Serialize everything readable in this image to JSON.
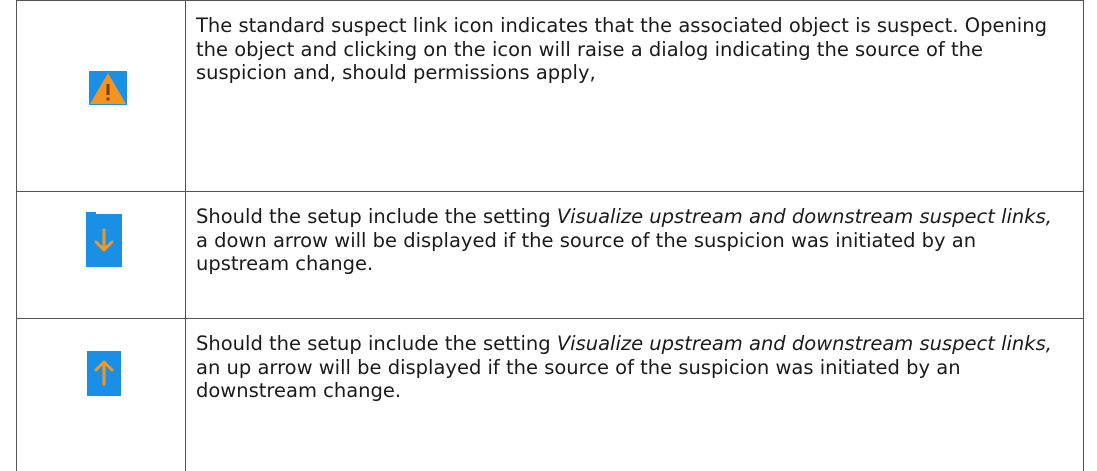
{
  "rows": [
    {
      "icon": "suspect-warning-icon",
      "text": "The standard suspect link icon indicates that the associated object is suspect. Opening the object and clicking on the icon will raise a dialog indicating the source of the suspicion and, should permissions apply,"
    },
    {
      "icon": "down-arrow-icon",
      "text_before": "Should the setup include the setting ",
      "text_italic": "Visualize upstream and downstream suspect links,",
      "text_after": " a down arrow will be displayed if the source of the suspicion was initiated by an upstream change."
    },
    {
      "icon": "up-arrow-icon",
      "text_before": "Should the setup include the setting ",
      "text_italic": "Visualize upstream and downstream suspect links,",
      "text_after": " an up arrow will be displayed if the source of the suspicion was initiated by an downstream change."
    }
  ],
  "colors": {
    "icon_background": "#1a8fe6",
    "icon_foreground": "#f7941d",
    "border": "#555555"
  }
}
